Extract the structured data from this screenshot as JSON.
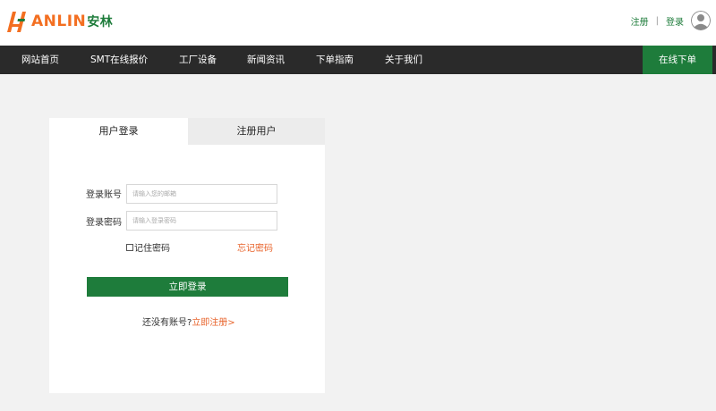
{
  "brand": {
    "logo_text": "ANLIN",
    "logo_cn": "安林",
    "primary_color": "#1e7c3b",
    "accent_color": "#f36f21"
  },
  "top_links": {
    "register": "注册",
    "separator": "|",
    "login": "登录",
    "avatar_icon": "user-avatar-icon"
  },
  "nav": {
    "items": [
      {
        "label": "网站首页"
      },
      {
        "label": "SMT在线报价"
      },
      {
        "label": "工厂设备"
      },
      {
        "label": "新闻资讯"
      },
      {
        "label": "下单指南"
      },
      {
        "label": "关于我们"
      }
    ],
    "cta": "在线下单",
    "background": "#2a2a2a"
  },
  "login_card": {
    "tabs": {
      "login": "用户登录",
      "register": "注册用户",
      "active": "login"
    },
    "account_label": "登录账号",
    "account_placeholder": "请输入您的邮箱",
    "password_label": "登录密码",
    "password_placeholder": "请输入登录密码",
    "remember_label": "记住密码",
    "forgot_label": "忘记密码",
    "submit_label": "立即登录",
    "no_account_text": "还没有账号?",
    "signup_link": "立即注册>"
  }
}
